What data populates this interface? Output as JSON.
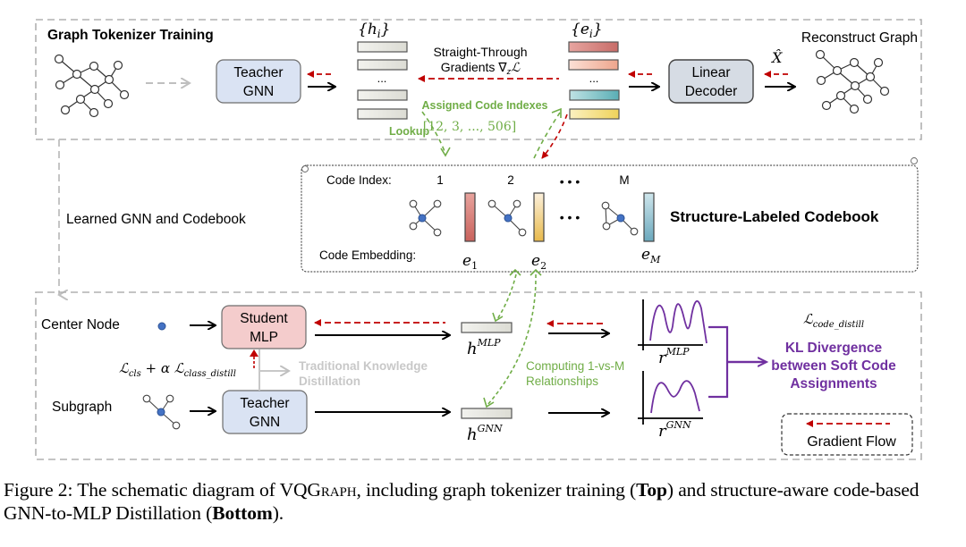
{
  "top_section": {
    "title": "Graph Tokenizer Training",
    "teacher_gnn": {
      "line1": "Teacher",
      "line2": "GNN"
    },
    "h_set_label": "{h",
    "h_set_sub": "i",
    "e_set_label": "{e",
    "e_set_sub": "i",
    "ellipsis": "...",
    "straight_through_line1": "Straight-Through",
    "straight_through_line2": "Gradients ∇",
    "straight_through_sub": "z",
    "straight_through_loss": "ℒ",
    "assigned_code_indexes": "Assigned Code Indexes",
    "index_list": "[12, 3, ..., 506]",
    "lookup": "Lookup",
    "linear_decoder": {
      "line1": "Linear",
      "line2": "Decoder"
    },
    "x_hat": "X̂",
    "reconstruct_graph": "Reconstruct Graph"
  },
  "middle_section": {
    "learned_label": "Learned GNN and Codebook",
    "code_index_label": "Code Index:",
    "code_embedding_label": "Code Embedding:",
    "codes": [
      {
        "index": "1",
        "embedding": "e",
        "sub": "1",
        "color_top": "#e8a39d",
        "color_bottom": "#c9625c"
      },
      {
        "index": "2",
        "embedding": "e",
        "sub": "2",
        "color_top": "#fbf0dc",
        "color_bottom": "#e8b94a"
      },
      {
        "index": "M",
        "embedding": "e",
        "sub": "M",
        "color_top": "#cfe6ec",
        "color_bottom": "#6aa8bd"
      }
    ],
    "dots": "• • •",
    "codebook_title": "Structure-Labeled Codebook"
  },
  "bottom_section": {
    "center_node": "Center Node",
    "subgraph": "Subgraph",
    "student_mlp": {
      "line1": "Student",
      "line2": "MLP"
    },
    "teacher_gnn": {
      "line1": "Teacher",
      "line2": "GNN"
    },
    "cls_loss": "ℒ",
    "cls_sub": "cls",
    "cls_plus": " + α ℒ",
    "class_distill_sub": "class_distill",
    "traditional_kd_line1": "Traditional Knowledge",
    "traditional_kd_line2": "Distillation",
    "h_mlp": "h",
    "h_mlp_sup": "MLP",
    "h_gnn": "h",
    "h_gnn_sup": "GNN",
    "computing_line1": "Computing 1-vs-M",
    "computing_line2": "Relationships",
    "r_mlp": "r",
    "r_mlp_sup": "MLP",
    "r_gnn": "r",
    "r_gnn_sup": "GNN",
    "code_distill_loss": "ℒ",
    "code_distill_sub": "code_distill",
    "kl_line1": "KL Divergence",
    "kl_line2": "between Soft Code",
    "kl_line3": "Assignments",
    "legend_label": "Gradient Flow"
  },
  "colors": {
    "teacher_fill": "#dae3f3",
    "student_fill": "#f4cccc",
    "decoder_fill": "#d6dce4",
    "gradient_red": "#c00000",
    "green": "#70ad47",
    "purple": "#7030a0",
    "node_blue": "#4472c4",
    "gray_dash": "#bfbfbf"
  },
  "caption": {
    "prefix": "Figure 2:  The schematic diagram of ",
    "name_big": "VQG",
    "name_small": "raph",
    "mid": ", including graph tokenizer training (",
    "top": "Top",
    "mid2": ") and structure-aware code-based GNN-to-MLP Distillation (",
    "bottom": "Bottom",
    "end": ")."
  }
}
